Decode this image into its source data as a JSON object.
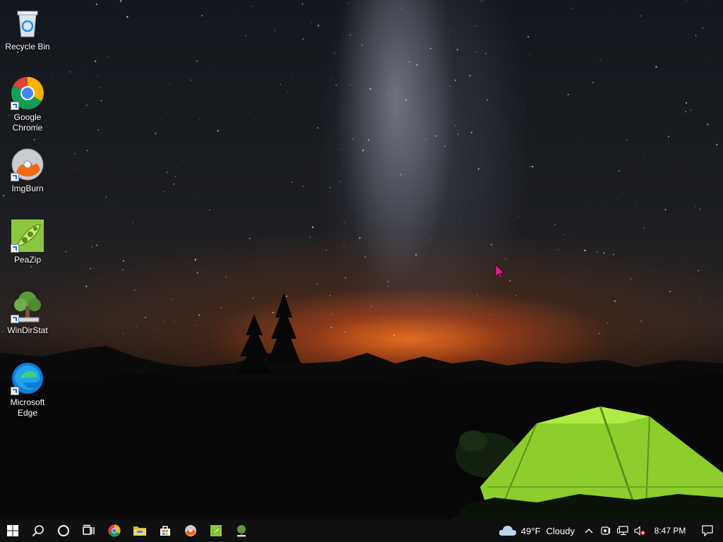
{
  "desktop": {
    "icons": [
      {
        "label": "Recycle Bin",
        "icon": "recycle-bin-icon"
      },
      {
        "label": "Google Chrome",
        "icon": "chrome-icon"
      },
      {
        "label": "ImgBurn",
        "icon": "imgburn-icon"
      },
      {
        "label": "PeaZip",
        "icon": "peazip-icon"
      },
      {
        "label": "WinDirStat",
        "icon": "windirstat-icon"
      },
      {
        "label": "Microsoft Edge",
        "icon": "edge-icon"
      }
    ]
  },
  "taskbar": {
    "pinned": [
      "start-icon",
      "search-icon",
      "cortana-icon",
      "task-view-icon",
      "chrome-icon",
      "file-explorer-icon",
      "store-icon",
      "imgburn-icon",
      "peazip-icon",
      "windirstat-icon"
    ],
    "weather": {
      "temp": "49°F",
      "condition": "Cloudy"
    },
    "clock": {
      "time": "8:47 PM"
    }
  },
  "colors": {
    "taskbar": "#101010",
    "tent": "#9be23a",
    "horizon_glow": "#f06e1e"
  }
}
